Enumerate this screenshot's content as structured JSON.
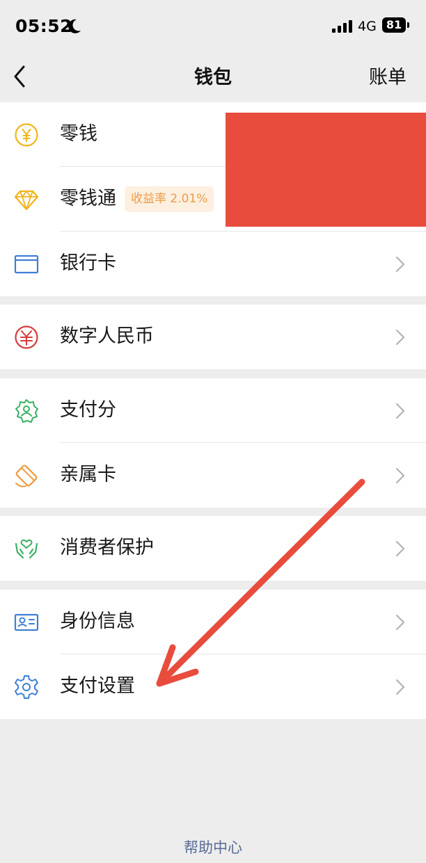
{
  "status_bar": {
    "time": "05:52",
    "moon_icon": "moon-icon",
    "signal_icon": "cellular-signal-icon",
    "network": "4G",
    "battery": "81"
  },
  "nav": {
    "back_icon": "chevron-left-icon",
    "title": "钱包",
    "action": "账单"
  },
  "groups": [
    {
      "rows": [
        {
          "icon": "yuan-coin-icon",
          "label": "零钱",
          "color": "#f3b31b",
          "chevron": false
        },
        {
          "icon": "diamond-icon",
          "label": "零钱通",
          "badge": "收益率 2.01%",
          "color": "#f3b31b",
          "chevron": false
        },
        {
          "icon": "bank-card-icon",
          "label": "银行卡",
          "color": "#3f7fd6",
          "chevron": true
        }
      ]
    },
    {
      "rows": [
        {
          "icon": "digital-rmb-icon",
          "label": "数字人民币",
          "color": "#d53b3b",
          "chevron": true
        }
      ]
    },
    {
      "rows": [
        {
          "icon": "pay-score-icon",
          "label": "支付分",
          "color": "#3ab065",
          "chevron": true
        },
        {
          "icon": "family-card-icon",
          "label": "亲属卡",
          "color": "#ee9a3f",
          "chevron": true
        }
      ]
    },
    {
      "rows": [
        {
          "icon": "protection-hands-icon",
          "label": "消费者保护",
          "color": "#3ab065",
          "chevron": true
        }
      ]
    },
    {
      "rows": [
        {
          "icon": "id-card-icon",
          "label": "身份信息",
          "color": "#3f7fd6",
          "chevron": true
        },
        {
          "icon": "gear-icon",
          "label": "支付设置",
          "color": "#3f7fd6",
          "chevron": true
        }
      ]
    }
  ],
  "footer": {
    "help_link": "帮助中心"
  },
  "colors": {
    "background": "#ededed",
    "redaction": "#e84c3d",
    "annotation_arrow": "#e84c3d",
    "link": "#576b95",
    "badge_text": "#ed9b48",
    "badge_bg": "#fdf0e0"
  }
}
